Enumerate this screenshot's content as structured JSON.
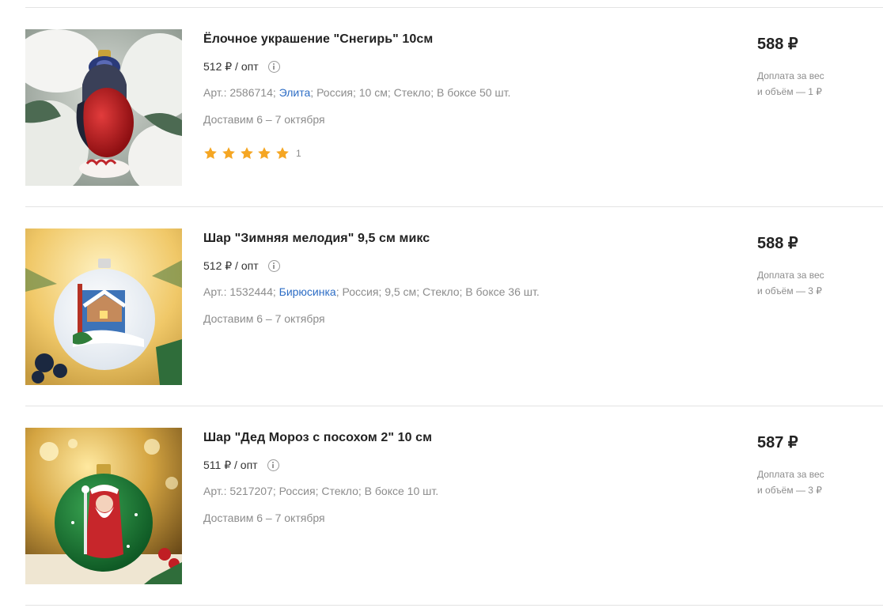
{
  "products": [
    {
      "title": "Ёлочное украшение \"Снегирь\" 10см",
      "wholesale": "512 ₽ / опт",
      "art": "Арт.: 2586714",
      "brand": "Элита",
      "specs": [
        "Россия",
        "10 см",
        "Стекло",
        "В боксе 50 шт."
      ],
      "delivery": "Доставим 6 – 7 октября",
      "rating": 5,
      "reviews": "1",
      "price": "588 ₽",
      "surcharge_line1": "Доплата за вес",
      "surcharge_line2": "и объём — 1 ₽",
      "image": "bullfinch-ornament"
    },
    {
      "title": "Шар \"Зимняя мелодия\" 9,5 см микс",
      "wholesale": "512 ₽ / опт",
      "art": "Арт.: 1532444",
      "brand": "Бирюсинка",
      "specs": [
        "Россия",
        "9,5 см",
        "Стекло",
        "В боксе 36 шт."
      ],
      "delivery": "Доставим 6 – 7 октября",
      "price": "588 ₽",
      "surcharge_line1": "Доплата за вес",
      "surcharge_line2": "и объём — 3 ₽",
      "image": "winter-melody-ball"
    },
    {
      "title": "Шар \"Дед Мороз с посохом 2\" 10 см",
      "wholesale": "511 ₽ / опт",
      "art": "Арт.: 5217207",
      "specs": [
        "Россия",
        "Стекло",
        "В боксе 10 шт."
      ],
      "delivery": "Доставим 6 – 7 октября",
      "price": "587 ₽",
      "surcharge_line1": "Доплата за вес",
      "surcharge_line2": "и объём — 3 ₽",
      "image": "ded-moroz-ball"
    }
  ],
  "colors": {
    "link": "#2d6dc5",
    "muted": "#8c8c8c",
    "star": "#f5a623",
    "divider": "#e3e3e3"
  }
}
